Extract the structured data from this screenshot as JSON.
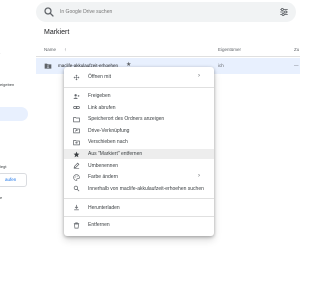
{
  "search": {
    "placeholder": "In Google Drive suchen"
  },
  "sidebar": {
    "fragments": [
      {
        "text": "eigeben"
      },
      {
        "text": "legt"
      },
      {
        "text": "e"
      }
    ],
    "button_label": "aufen"
  },
  "main": {
    "title": "Markiert",
    "columns": {
      "name": "Name",
      "owner": "Eigentümer",
      "last_col": "Zu"
    },
    "file": {
      "name": "maclife-akkulaufzeit-erhoehen",
      "owner": "ich",
      "extra": "—"
    }
  },
  "context_menu": {
    "items": [
      {
        "label": "Öffnen mit",
        "icon": "open-with-icon",
        "submenu": true
      },
      {
        "label": "Freigeben",
        "icon": "person-add-icon"
      },
      {
        "label": "Link abrufen",
        "icon": "link-icon"
      },
      {
        "label": "Speicherort des Ordners anzeigen",
        "icon": "folder-icon"
      },
      {
        "label": "Drive-Verknüpfung",
        "icon": "add-shortcut-icon"
      },
      {
        "label": "Verschieben nach",
        "icon": "move-to-icon"
      },
      {
        "label": "Aus \"Markiert\" entfernen",
        "icon": "star-icon",
        "highlighted": true
      },
      {
        "label": "Umbenennen",
        "icon": "pencil-icon"
      },
      {
        "label": "Farbe ändern",
        "icon": "palette-icon",
        "submenu": true
      },
      {
        "label": "Innerhalb von maclife-akkulaufzeit-erhoehen suchen",
        "icon": "search-icon"
      },
      {
        "label": "Herunterladen",
        "icon": "download-icon"
      },
      {
        "label": "Entfernen",
        "icon": "trash-icon"
      }
    ]
  },
  "colors": {
    "accent": "#1a73e8",
    "selected_row": "#e8f0fe",
    "menu_highlight": "#ededed"
  }
}
